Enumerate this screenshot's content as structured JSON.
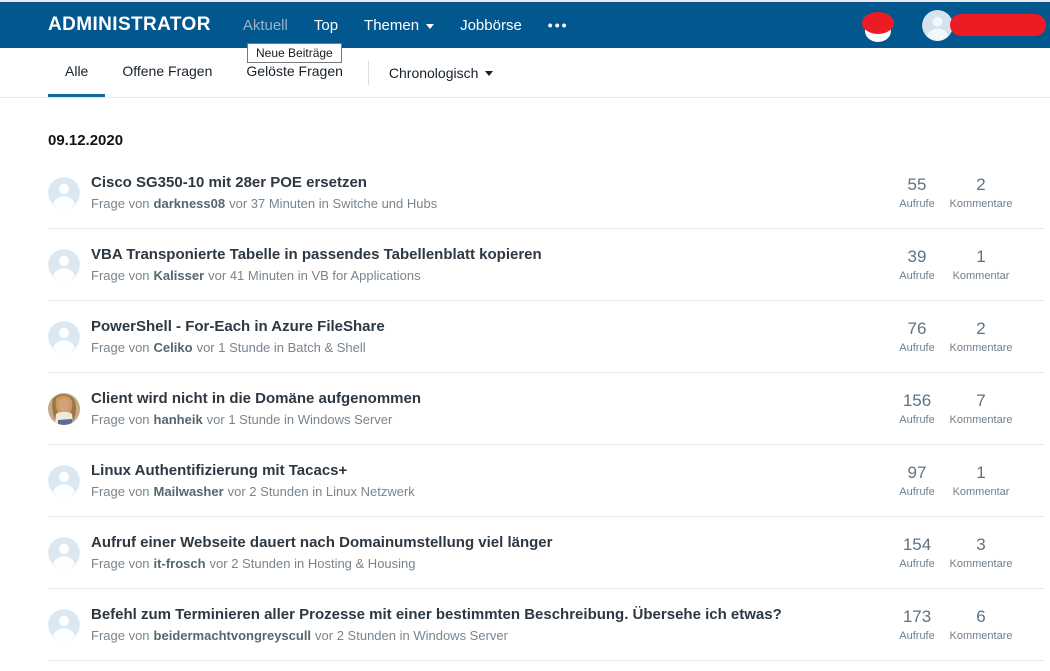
{
  "colors": {
    "header_bg": "#02578f",
    "accent_blue": "#11679f",
    "redaction": "#ed1c24",
    "title_text": "#2d3842",
    "meta_text": "#78858f",
    "author_text": "#56666f",
    "stat_number": "#5d7384",
    "stat_label": "#6e7f8d",
    "divider": "#dfe8ee",
    "avatar_bg": "#dce8f1"
  },
  "header": {
    "logo": "ADMINISTRATOR",
    "nav_items": [
      {
        "label": "Aktuell"
      },
      {
        "label": "Top"
      },
      {
        "label": "Themen"
      },
      {
        "label": "Jobbörse"
      },
      {
        "label": "•••"
      }
    ]
  },
  "tooltip": {
    "text": "Neue Beiträge"
  },
  "tabbar": {
    "tabs": [
      {
        "label": "Alle"
      },
      {
        "label": "Offene Fragen"
      },
      {
        "label": "Gelöste Fragen"
      }
    ],
    "sort_label": "Chronologisch"
  },
  "content": {
    "date_heading": "09.12.2020",
    "meta_prefix": "Frage von",
    "threads": [
      {
        "title": "Cisco SG350-10 mit 28er POE ersetzen",
        "author": "darkness08",
        "meta_rest": "vor 37 Minuten in Switche und Hubs",
        "views": "55",
        "views_label": "Aufrufe",
        "comments": "2",
        "comments_label": "Kommentare",
        "avatar": "default"
      },
      {
        "title": "VBA Transponierte Tabelle in passendes Tabellenblatt kopieren",
        "author": "Kalisser",
        "meta_rest": "vor 41 Minuten in VB for Applications",
        "views": "39",
        "views_label": "Aufrufe",
        "comments": "1",
        "comments_label": "Kommentar",
        "avatar": "default"
      },
      {
        "title": "PowerShell - For-Each in Azure FileShare",
        "author": "Celiko",
        "meta_rest": "vor 1 Stunde in Batch & Shell",
        "views": "76",
        "views_label": "Aufrufe",
        "comments": "2",
        "comments_label": "Kommentare",
        "avatar": "default"
      },
      {
        "title": "Client wird nicht in die Domäne aufgenommen",
        "author": "hanheik",
        "meta_rest": "vor 1 Stunde in Windows Server",
        "views": "156",
        "views_label": "Aufrufe",
        "comments": "7",
        "comments_label": "Kommentare",
        "avatar": "photo"
      },
      {
        "title": "Linux Authentifizierung mit Tacacs+",
        "author": "Mailwasher",
        "meta_rest": "vor 2 Stunden in Linux Netzwerk",
        "views": "97",
        "views_label": "Aufrufe",
        "comments": "1",
        "comments_label": "Kommentar",
        "avatar": "default"
      },
      {
        "title": "Aufruf einer Webseite dauert nach Domainumstellung viel länger",
        "author": "it-frosch",
        "meta_rest": "vor 2 Stunden in Hosting & Housing",
        "views": "154",
        "views_label": "Aufrufe",
        "comments": "3",
        "comments_label": "Kommentare",
        "avatar": "default"
      },
      {
        "title": "Befehl zum Terminieren aller Prozesse mit einer bestimmten Beschreibung. Übersehe ich etwas?",
        "author": "beidermachtvongreyscull",
        "meta_rest": "vor 2 Stunden in Windows Server",
        "views": "173",
        "views_label": "Aufrufe",
        "comments": "6",
        "comments_label": "Kommentare",
        "avatar": "default"
      }
    ]
  }
}
